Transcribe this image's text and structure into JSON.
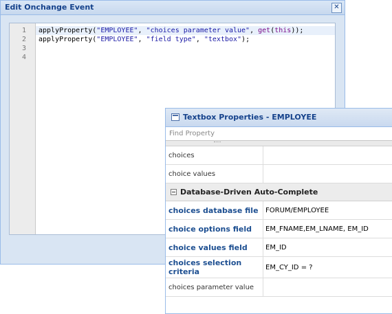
{
  "dialog": {
    "title": "Edit Onchange Event",
    "close_glyph": "✕",
    "code_lines": [
      {
        "number": "1",
        "parts": [
          {
            "text": "applyProperty(",
            "cls": ""
          },
          {
            "text": "\"EMPLOYEE\"",
            "cls": "s"
          },
          {
            "text": ", ",
            "cls": ""
          },
          {
            "text": "\"choices parameter value\"",
            "cls": "s"
          },
          {
            "text": ", ",
            "cls": ""
          },
          {
            "text": "get",
            "cls": "k"
          },
          {
            "text": "(",
            "cls": ""
          },
          {
            "text": "this",
            "cls": "k"
          },
          {
            "text": "));",
            "cls": ""
          }
        ]
      },
      {
        "number": "2",
        "parts": [
          {
            "text": "applyProperty(",
            "cls": ""
          },
          {
            "text": "\"EMPLOYEE\"",
            "cls": "s"
          },
          {
            "text": ", ",
            "cls": ""
          },
          {
            "text": "\"field type\"",
            "cls": "s"
          },
          {
            "text": ", ",
            "cls": ""
          },
          {
            "text": "\"textbox\"",
            "cls": "s"
          },
          {
            "text": ");",
            "cls": ""
          }
        ]
      },
      {
        "number": "3",
        "parts": []
      },
      {
        "number": "4",
        "parts": []
      }
    ]
  },
  "properties": {
    "title": "Textbox Properties - EMPLOYEE",
    "find_placeholder": "Find Property",
    "rows_top": [
      {
        "label": "choices",
        "value": ""
      },
      {
        "label": "choice values",
        "value": ""
      }
    ],
    "section": "Database-Driven Auto-Complete",
    "rows_section": [
      {
        "label": "choices database file",
        "value": "FORUM/EMPLOYEE",
        "bold": true
      },
      {
        "label": "choice options field",
        "value": "EM_FNAME,EM_LNAME, EM_ID",
        "bold": true
      },
      {
        "label": "choice values field",
        "value": "EM_ID",
        "bold": true
      },
      {
        "label": "choices selection criteria",
        "value": "EM_CY_ID = ?",
        "bold": true
      },
      {
        "label": "choices parameter value",
        "value": "",
        "bold": false
      }
    ]
  }
}
